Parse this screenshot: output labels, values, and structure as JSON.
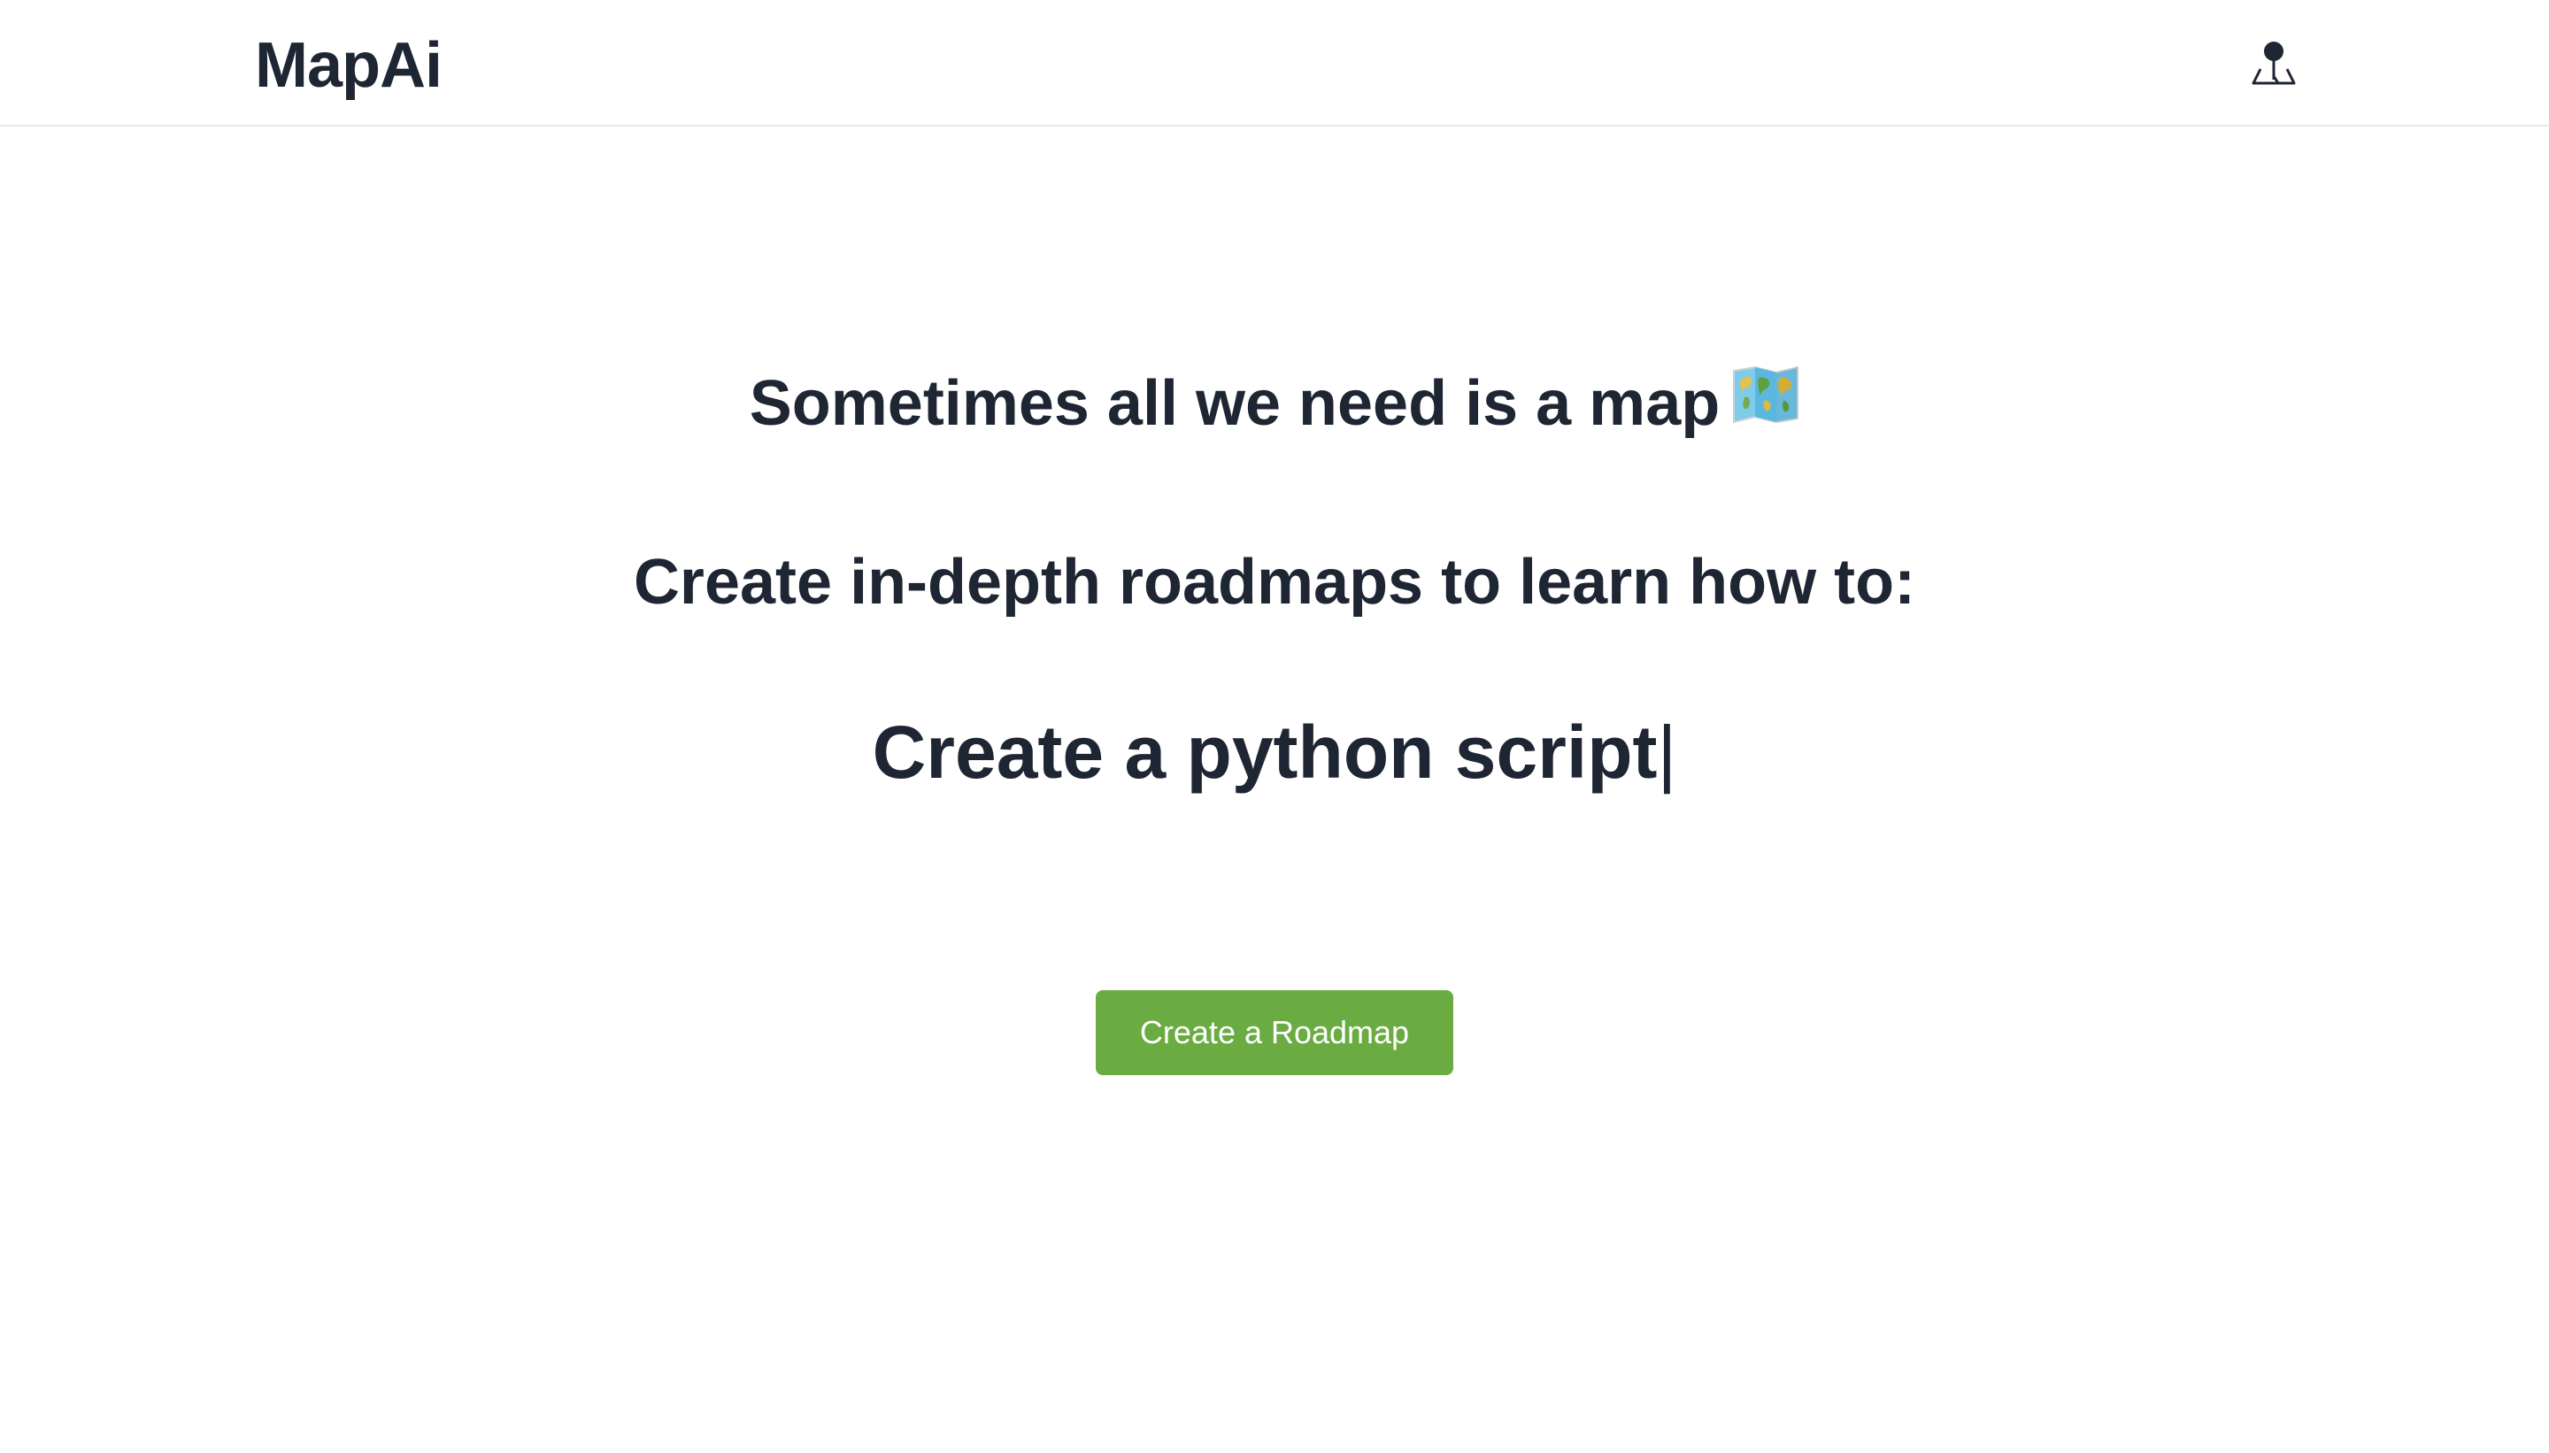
{
  "header": {
    "brand": "MapAi",
    "profile_icon": "user-pin-icon"
  },
  "hero": {
    "headline": "Sometimes all we need is a map",
    "headline_emoji_icon": "world-map-icon",
    "subheadline": "Create in-depth roadmaps to learn how to:",
    "typed_text": "Create a python script",
    "cursor": "|",
    "cta_label": "Create a Roadmap"
  },
  "colors": {
    "text": "#1f2633",
    "accent": "#6aac42",
    "divider": "#e5e7eb",
    "background": "#ffffff"
  }
}
